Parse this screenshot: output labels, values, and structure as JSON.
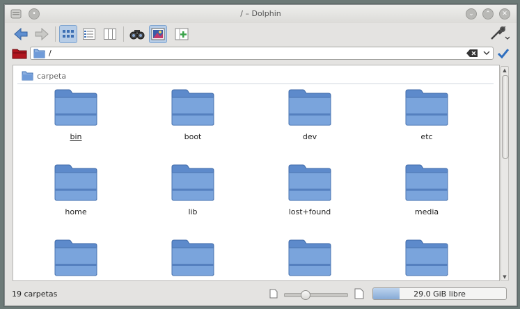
{
  "window": {
    "title": "/ – Dolphin"
  },
  "toolbar": {
    "buttons": [
      {
        "name": "back-button",
        "icon": "arrow-left-icon"
      },
      {
        "name": "forward-button",
        "icon": "arrow-right-icon"
      },
      {
        "name": "icons-view-button",
        "icon": "icons-view-icon",
        "active": true
      },
      {
        "name": "details-view-button",
        "icon": "details-view-icon"
      },
      {
        "name": "columns-view-button",
        "icon": "columns-view-icon"
      },
      {
        "name": "find-button",
        "icon": "binoculars-icon"
      },
      {
        "name": "preview-button",
        "icon": "preview-icon",
        "active": true
      },
      {
        "name": "split-button",
        "icon": "split-add-icon"
      },
      {
        "name": "settings-button",
        "icon": "wrench-icon"
      }
    ]
  },
  "location": {
    "path": "/"
  },
  "group": {
    "label": "carpeta"
  },
  "folders": [
    {
      "label": "bin",
      "focused": true
    },
    {
      "label": "boot"
    },
    {
      "label": "dev"
    },
    {
      "label": "etc"
    },
    {
      "label": "home"
    },
    {
      "label": "lib"
    },
    {
      "label": "lost+found"
    },
    {
      "label": "media"
    },
    {
      "label": ""
    },
    {
      "label": ""
    },
    {
      "label": ""
    },
    {
      "label": ""
    }
  ],
  "status": {
    "summary": "19 carpetas",
    "free_space": "29.0 GiB libre",
    "space_used_fraction": 0.2,
    "zoom_level_fraction": 0.3
  },
  "colors": {
    "folder_blue": "#6f9bd8",
    "accent": "#7da3cf",
    "places_red": "#b0161f"
  }
}
